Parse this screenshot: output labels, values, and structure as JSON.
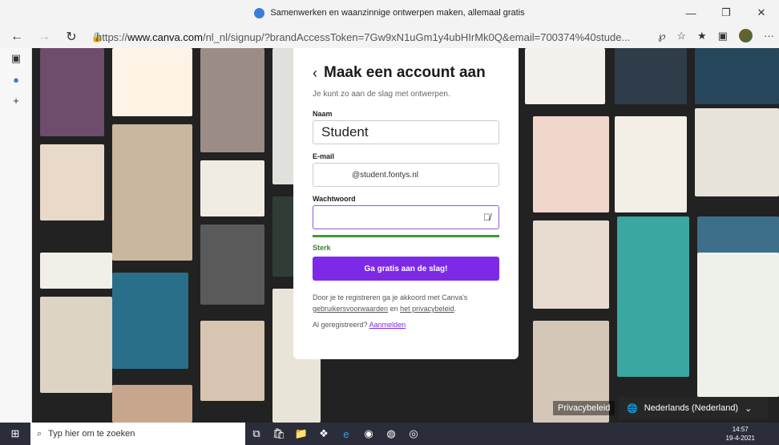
{
  "window": {
    "title": "Samenwerken en waanzinnige ontwerpen maken, allemaal gratis"
  },
  "address": {
    "prefix": "https://",
    "domain": "www.canva.com",
    "path": "/nl_nl/signup/?brandAccessToken=7Gw9xN1uGm1y4ubHIrMk0Q&email=700374%40stude..."
  },
  "modal": {
    "title": "Maak een account aan",
    "subtitle": "Je kunt zo aan de slag met ontwerpen.",
    "name_label": "Naam",
    "name_value": "Student",
    "email_label": "E-mail",
    "email_value": "@student.fontys.nl",
    "password_label": "Wachtwoord",
    "password_value": "",
    "strength_label": "Sterk",
    "cta_label": "Ga gratis aan de slag!",
    "legal_prefix": "Door je te registreren ga je akkoord met Canva's",
    "legal_terms": "gebruikersvoorwaarden",
    "legal_and": "en",
    "legal_privacy": "het privacybeleid",
    "already_prefix": "Al geregistreerd?",
    "already_link": "Aanmelden"
  },
  "footer": {
    "privacy": "Privacybeleid",
    "language": "Nederlands (Nederland)"
  },
  "taskbar": {
    "search_placeholder": "Typ hier om te zoeken",
    "time": "14:57",
    "date": "19-4-2021"
  },
  "colors": {
    "accent": "#7d2ae8",
    "strength": "#3d9b32"
  },
  "icons": [
    "back-icon",
    "forward-icon",
    "reload-icon",
    "lock-icon",
    "eye-off-icon",
    "globe-icon",
    "windows-icon",
    "search-icon"
  ]
}
